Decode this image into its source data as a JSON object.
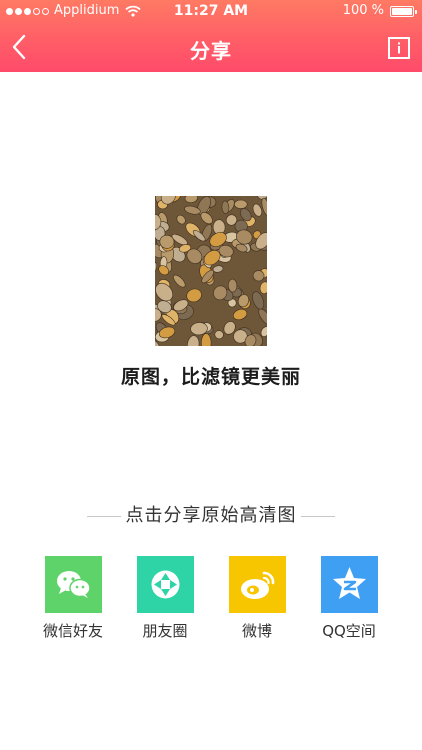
{
  "status_bar": {
    "carrier": "Applidium",
    "time": "11:27 AM",
    "battery": "100 %"
  },
  "nav": {
    "title": "分享",
    "back_icon": "chevron-left-icon",
    "info_icon": "info-icon"
  },
  "photo_caption": "原图，比滤镜更美丽",
  "share_heading": "点击分享原始高清图",
  "share_options": [
    {
      "label": "微信好友",
      "icon": "wechat-icon",
      "color": "#5dd36a"
    },
    {
      "label": "朋友圈",
      "icon": "moments-icon",
      "color": "#2ed3a6"
    },
    {
      "label": "微博",
      "icon": "weibo-icon",
      "color": "#f7c600"
    },
    {
      "label": "QQ空间",
      "icon": "qzone-icon",
      "color": "#3f9ff2"
    }
  ],
  "colors": {
    "header_gradient_top": "#ff7a63",
    "header_gradient_bottom": "#ff4b6a"
  }
}
